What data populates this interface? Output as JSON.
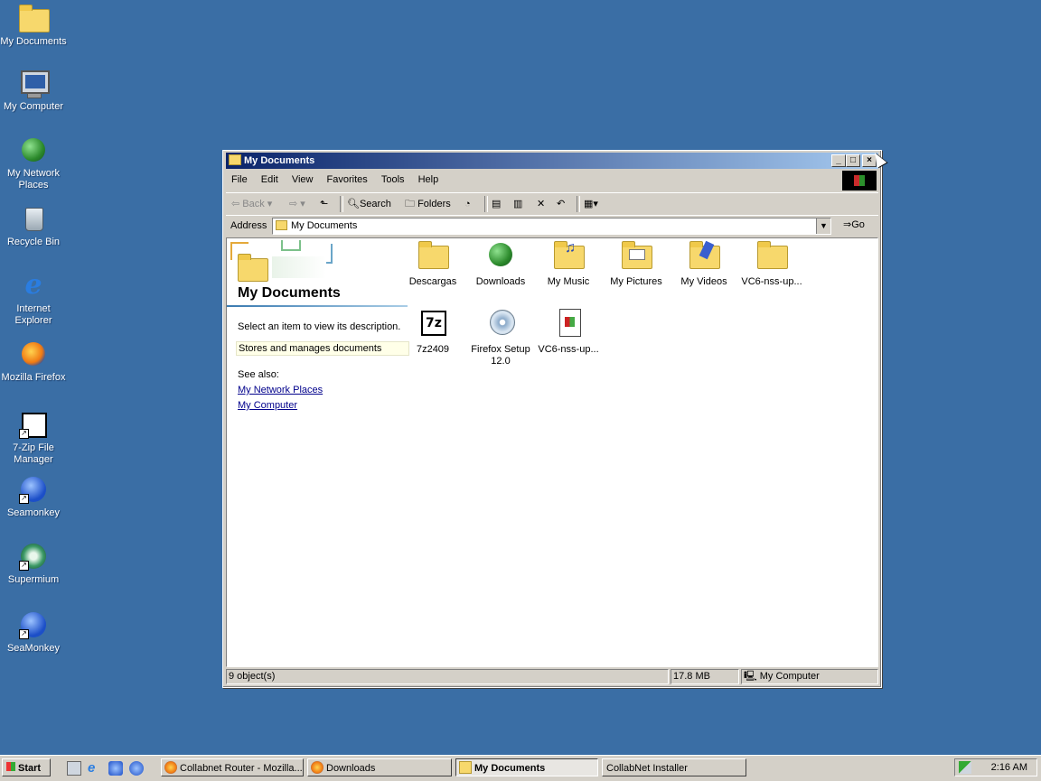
{
  "desktop": {
    "icons": [
      {
        "label": "My Documents",
        "icon": "folder-icon"
      },
      {
        "label": "My Computer",
        "icon": "computer-icon"
      },
      {
        "label": "My Network\nPlaces",
        "icon": "network-places-icon"
      },
      {
        "label": "Recycle Bin",
        "icon": "recycle-bin-icon"
      },
      {
        "label": "Internet\nExplorer",
        "icon": "internet-explorer-icon"
      },
      {
        "label": "Mozilla Firefox",
        "icon": "firefox-icon"
      },
      {
        "label": "7-Zip File\nManager",
        "icon": "7zip-icon"
      },
      {
        "label": "Seamonkey",
        "icon": "seamonkey-icon"
      },
      {
        "label": "Supermium",
        "icon": "supermium-icon"
      },
      {
        "label": "SeaMonkey",
        "icon": "seamonkey-icon"
      }
    ]
  },
  "window": {
    "title": "My Documents",
    "controls": {
      "minimize": "_",
      "maximize": "□",
      "close": "×"
    },
    "menu": [
      "File",
      "Edit",
      "View",
      "Favorites",
      "Tools",
      "Help"
    ],
    "toolbar": {
      "back": "Back",
      "search": "Search",
      "folders": "Folders"
    },
    "address": {
      "label": "Address",
      "value": "My Documents",
      "go": "Go"
    },
    "left_pane": {
      "title": "My Documents",
      "description": "Select an item to view its description.",
      "hint": "Stores and manages documents",
      "see_also": "See also:",
      "links": [
        "My Network Places",
        "My Computer"
      ]
    },
    "files": [
      {
        "name": "Descargas",
        "icon": "folder-icon"
      },
      {
        "name": "Downloads",
        "icon": "downloads-globe-icon"
      },
      {
        "name": "My Music",
        "icon": "music-folder-icon"
      },
      {
        "name": "My Pictures",
        "icon": "pictures-folder-icon"
      },
      {
        "name": "My Videos",
        "icon": "videos-folder-icon"
      },
      {
        "name": "VC6-nss-up...",
        "icon": "folder-icon"
      },
      {
        "name": "7z2409",
        "icon": "7zip-archive-icon"
      },
      {
        "name": "Firefox Setup\n12.0",
        "icon": "installer-cd-icon"
      },
      {
        "name": "VC6-nss-up...",
        "icon": "document-icon"
      }
    ],
    "status": {
      "objects": "9 object(s)",
      "size": "17.8 MB",
      "zone": "My Computer"
    }
  },
  "taskbar": {
    "start": "Start",
    "tasks": [
      {
        "label": "Collabnet Router - Mozilla...",
        "active": false
      },
      {
        "label": "Downloads",
        "active": false
      },
      {
        "label": "My Documents",
        "active": true
      },
      {
        "label": "CollabNet Installer",
        "active": false
      }
    ],
    "clock": "2:16 AM"
  }
}
